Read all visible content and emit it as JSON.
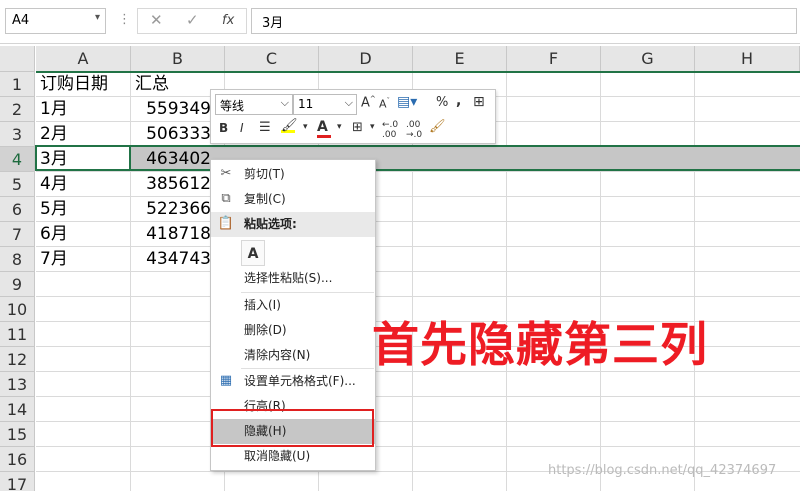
{
  "formula_bar": {
    "name_box": "A4",
    "separator": "⋮",
    "cancel": "✕",
    "enter": "✓",
    "fx": "fx",
    "content": "3月"
  },
  "columns": [
    "A",
    "B",
    "C",
    "D",
    "E",
    "F",
    "G",
    "H"
  ],
  "rows": [
    "1",
    "2",
    "3",
    "4",
    "5",
    "6",
    "7",
    "8",
    "9",
    "10",
    "11",
    "12",
    "13",
    "14",
    "15",
    "16",
    "17"
  ],
  "table": {
    "headers": [
      "订购日期",
      "汇总"
    ],
    "months": [
      "1月",
      "2月",
      "3月",
      "4月",
      "5月",
      "6月",
      "7月"
    ],
    "totals": [
      "559349",
      "506333",
      "463402",
      "385612",
      "522366",
      "418718",
      "434743"
    ]
  },
  "mini_toolbar": {
    "font": "等线",
    "size": "11",
    "percent": "%",
    "comma": ",",
    "bold": "B",
    "italic": "I",
    "font_color_letter": "A",
    "highlight_color": "#ffff00",
    "font_color": "#e02020"
  },
  "context_menu": {
    "cut": "剪切(T)",
    "copy": "复制(C)",
    "paste_options": "粘贴选项:",
    "paste_special": "选择性粘贴(S)...",
    "insert": "插入(I)",
    "delete": "删除(D)",
    "clear": "清除内容(N)",
    "format_cells": "设置单元格格式(F)...",
    "row_height": "行高(R)",
    "hide": "隐藏(H)",
    "unhide": "取消隐藏(U)"
  },
  "annotation": "首先隐藏第三列",
  "watermark": "https://blog.csdn.net/qq_42374697",
  "colors": {
    "excel_green": "#217346",
    "annotation_red": "#ee1c24"
  }
}
